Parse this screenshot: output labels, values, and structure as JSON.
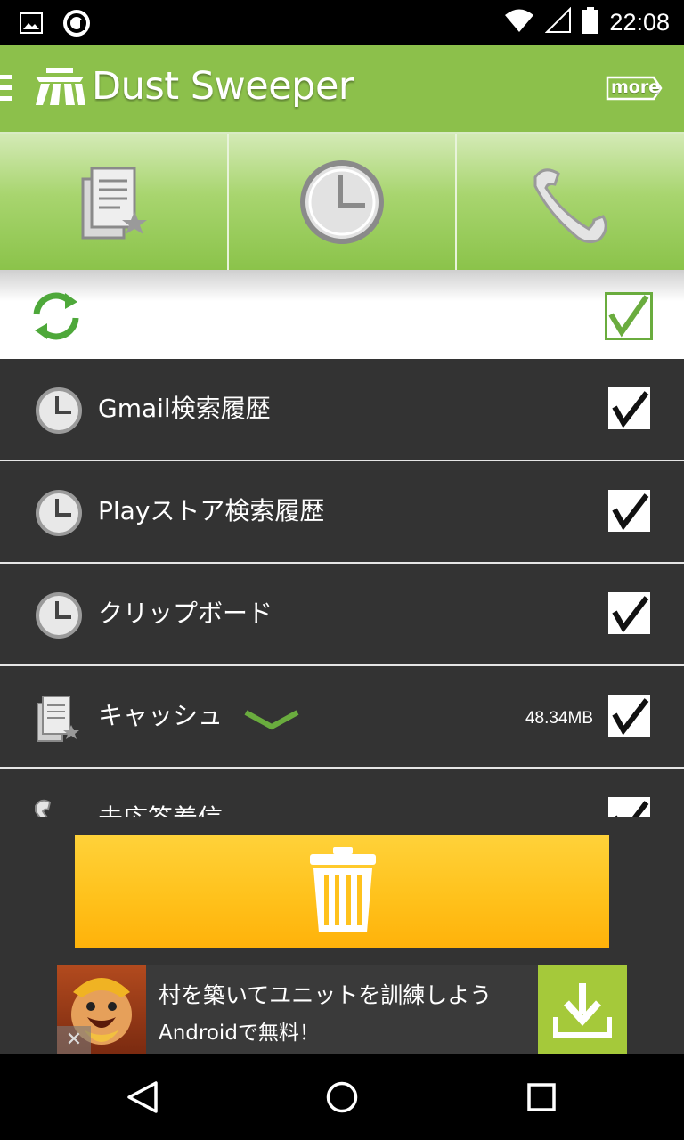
{
  "status_bar": {
    "time": "22:08",
    "icons": [
      "gallery-icon",
      "sync-icon",
      "wifi-icon",
      "signal-icon",
      "battery-icon"
    ]
  },
  "app_bar": {
    "title": "Dust Sweeper",
    "more_label": "more",
    "accent_color": "#8cc04b"
  },
  "tabs": [
    {
      "icon": "cache-document-icon"
    },
    {
      "icon": "history-clock-icon"
    },
    {
      "icon": "phone-handset-icon"
    }
  ],
  "toolbar": {
    "refresh_icon": "refresh-icon",
    "select_all_checked": true
  },
  "list": {
    "items": [
      {
        "label": "Gmail検索履歴",
        "icon": "clock-icon",
        "size": "",
        "checked": true
      },
      {
        "label": "Playストア検索履歴",
        "icon": "clock-icon",
        "size": "",
        "checked": true
      },
      {
        "label": "クリップボード",
        "icon": "clock-icon",
        "size": "",
        "checked": true
      },
      {
        "label": "キャッシュ",
        "icon": "document-icon",
        "size": "48.34MB",
        "checked": true,
        "expandable": true
      },
      {
        "label": "未応答着信",
        "icon": "phone-icon",
        "size": "",
        "checked": true
      }
    ]
  },
  "delete_button": {
    "icon": "trash-icon",
    "color": "#ffc21c"
  },
  "ad": {
    "line1": "村を築いてユニットを訓練しよう",
    "line2": "Androidで無料！",
    "close_glyph": "✕",
    "download_color": "#a5c93a"
  },
  "nav_bar": {
    "buttons": [
      "back-icon",
      "home-icon",
      "recents-icon"
    ]
  }
}
